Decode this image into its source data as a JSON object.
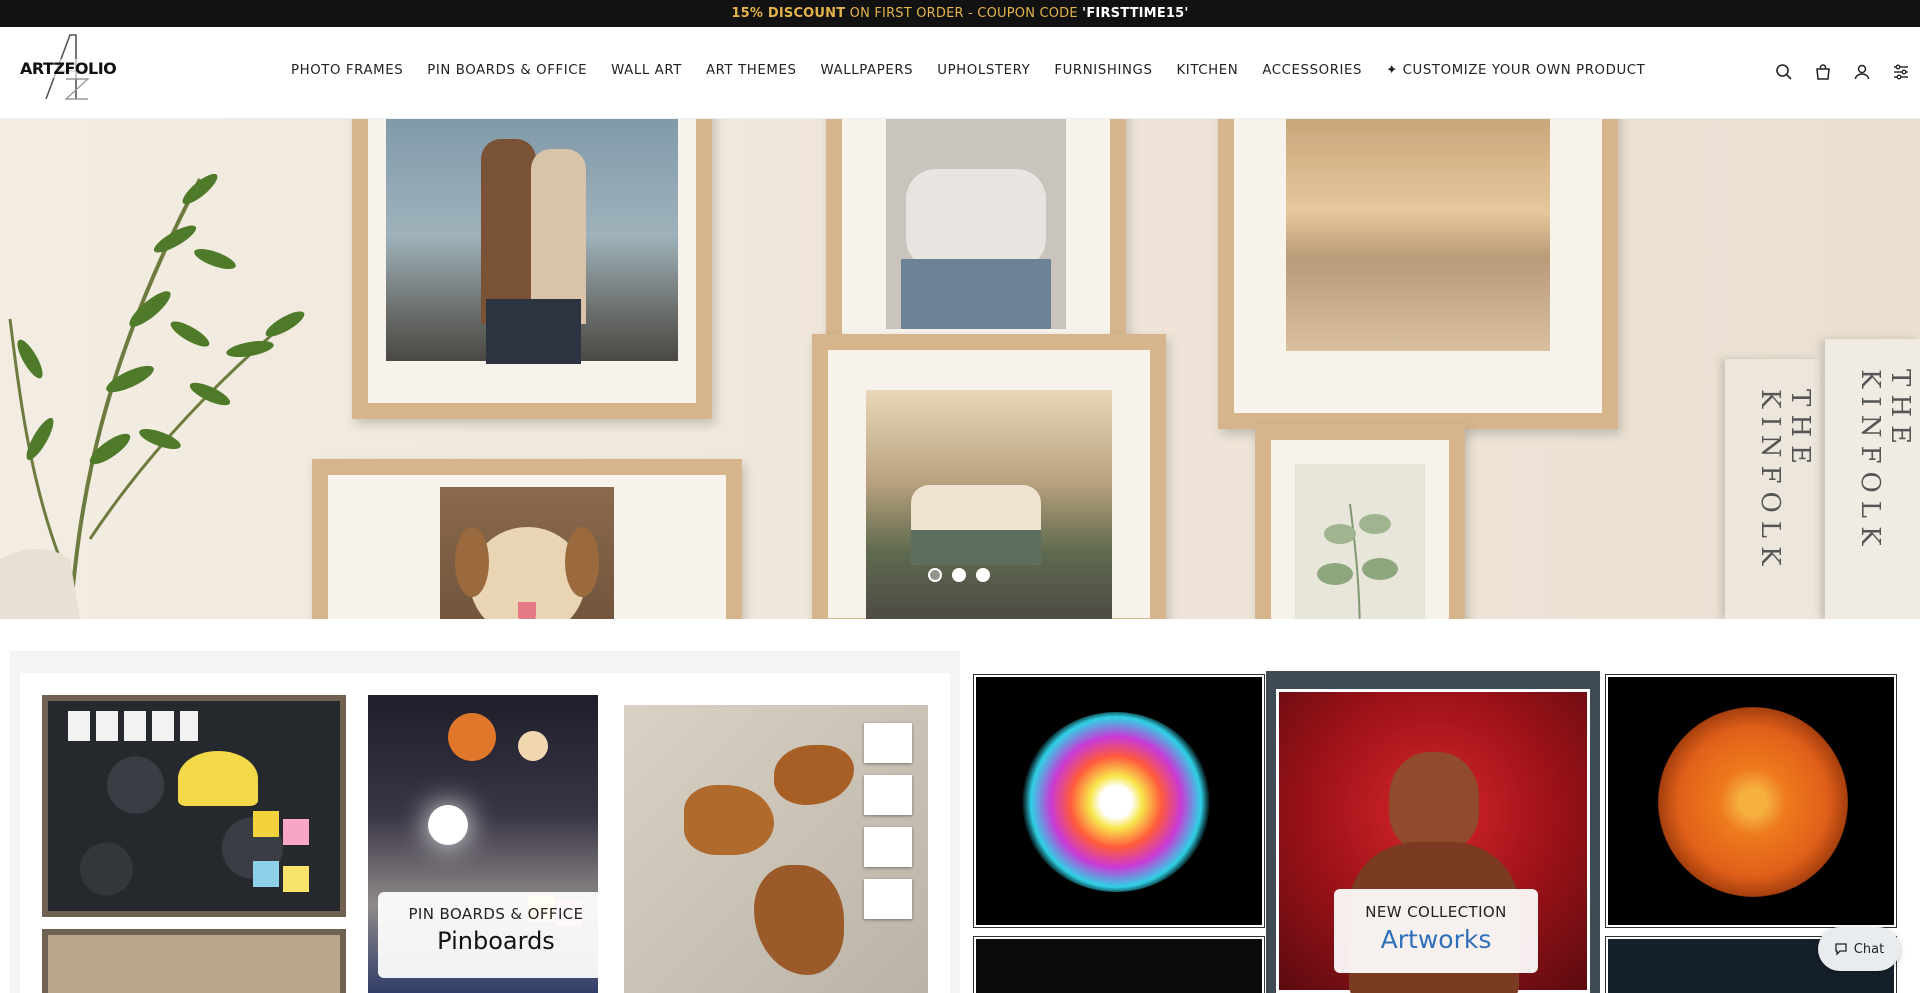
{
  "announcement": {
    "discount": "15% DISCOUNT",
    "middle": " ON FIRST ORDER - COUPON CODE ",
    "code": "'FIRSTTIME15'"
  },
  "brand": {
    "name": "ARTZFOLIO"
  },
  "nav": {
    "items": [
      "PHOTO FRAMES",
      "PIN BOARDS & OFFICE",
      "WALL ART",
      "ART THEMES",
      "WALLPAPERS",
      "UPHOLSTERY",
      "FURNISHINGS",
      "KITCHEN",
      "ACCESSORIES",
      "✦ CUSTOMIZE YOUR OWN PRODUCT"
    ]
  },
  "header_icons": [
    "search-icon",
    "cart-icon",
    "account-icon",
    "filter-icon"
  ],
  "hero": {
    "slides": 3,
    "active_slide": 1,
    "book_spine_text": "THE KINFOLK"
  },
  "collections": {
    "left": {
      "eyebrow": "PIN BOARDS & OFFICE",
      "title": "Pinboards"
    },
    "right": {
      "eyebrow": "NEW COLLECTION",
      "title": "Artworks"
    }
  },
  "chat": {
    "label": "Chat"
  },
  "colors": {
    "announce_bg": "#121212",
    "announce_gold": "#e2b34a",
    "accent_blue": "#2f6fba",
    "frame_wood": "#d7b58c"
  }
}
